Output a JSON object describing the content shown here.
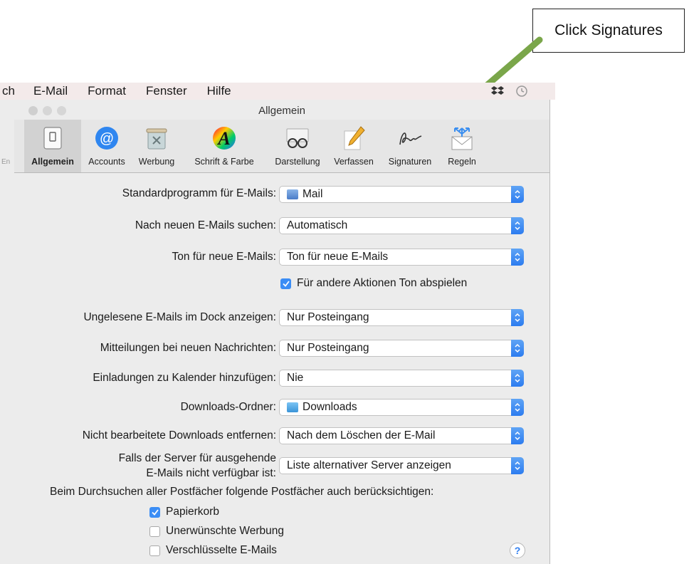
{
  "callout": {
    "text": "Click Signatures"
  },
  "menubar": {
    "items": [
      "ch",
      "E-Mail",
      "Format",
      "Fenster",
      "Hilfe"
    ]
  },
  "sidebar_fragment": {
    "text": "En"
  },
  "window": {
    "title": "Allgemein",
    "toolbar": [
      {
        "label": "Allgemein",
        "icon": "switch-icon",
        "selected": true
      },
      {
        "label": "Accounts",
        "icon": "at-icon"
      },
      {
        "label": "Werbung",
        "icon": "trash-icon"
      },
      {
        "label": "Schrift & Farbe",
        "icon": "font-color-icon"
      },
      {
        "label": "Darstellung",
        "icon": "glasses-icon"
      },
      {
        "label": "Verfassen",
        "icon": "pencil-icon"
      },
      {
        "label": "Signaturen",
        "icon": "signature-icon"
      },
      {
        "label": "Regeln",
        "icon": "rules-envelope-icon"
      }
    ]
  },
  "settings": [
    {
      "label": "Standardprogramm für E-Mails:",
      "value": "Mail",
      "icon": "mail-app-icon"
    },
    {
      "label": "Nach neuen E-Mails suchen:",
      "value": "Automatisch"
    },
    {
      "label": "Ton für neue E-Mails:",
      "value": "Ton für neue E-Mails"
    },
    {
      "label": "Ungelesene E-Mails im Dock anzeigen:",
      "value": "Nur Posteingang"
    },
    {
      "label": "Mitteilungen bei neuen Nachrichten:",
      "value": "Nur Posteingang"
    },
    {
      "label": "Einladungen zu Kalender hinzufügen:",
      "value": "Nie"
    },
    {
      "label": "Downloads-Ordner:",
      "value": "Downloads",
      "icon": "folder-icon"
    },
    {
      "label": "Nicht bearbeitete Downloads entfernen:",
      "value": "Nach dem Löschen der E-Mail"
    },
    {
      "label_line1": "Falls der Server für ausgehende",
      "label_line2": "E-Mails nicht verfügbar ist:",
      "value": "Liste alternativer Server anzeigen"
    }
  ],
  "sound_checkbox": {
    "label": "Für andere Aktionen Ton abspielen",
    "checked": true
  },
  "search_heading": "Beim Durchsuchen aller Postfächer folgende Postfächer auch berücksichtigen:",
  "search_checkboxes": [
    {
      "label": "Papierkorb",
      "checked": true
    },
    {
      "label": "Unerwünschte Werbung",
      "checked": false
    },
    {
      "label": "Verschlüsselte E-Mails",
      "checked": false
    }
  ],
  "help": {
    "text": "?"
  },
  "colors": {
    "accent_blue": "#3b8df5",
    "arrow_green": "#6b9a3e"
  }
}
